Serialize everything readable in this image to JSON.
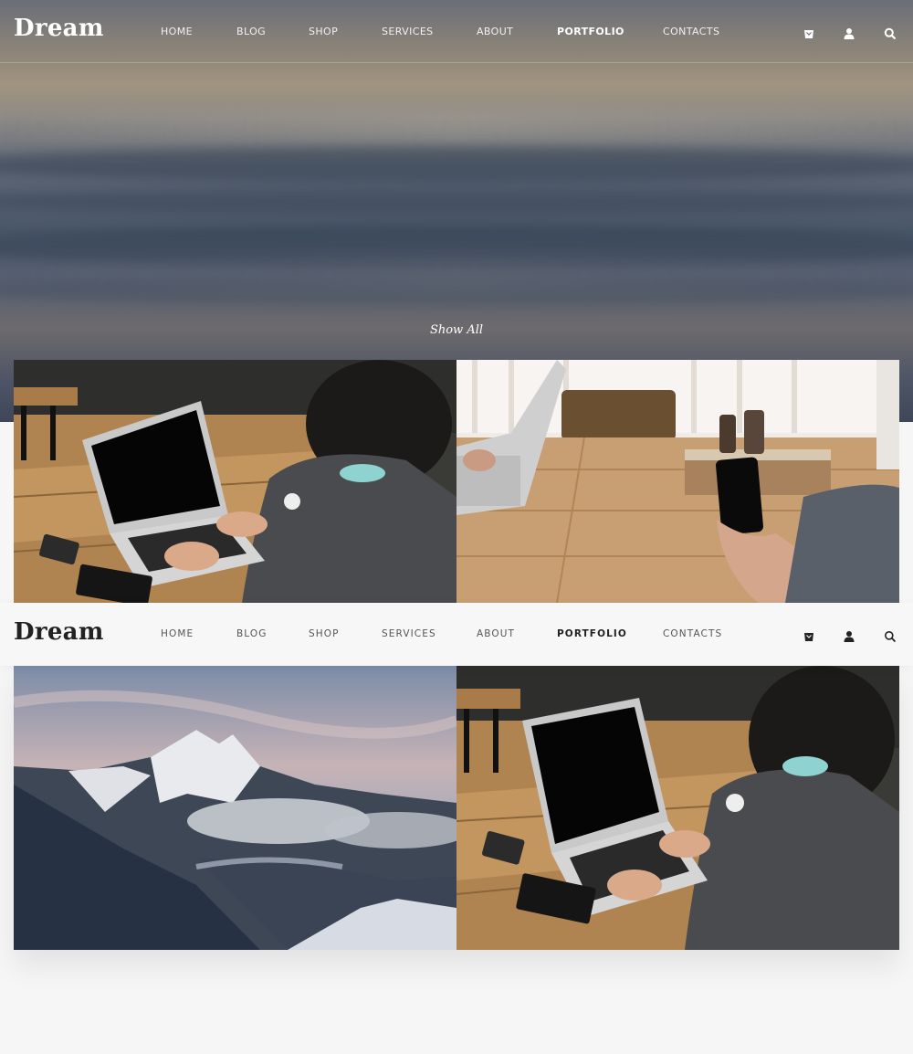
{
  "brand": {
    "logo": "Dream"
  },
  "nav": {
    "items": [
      {
        "label": "HOME"
      },
      {
        "label": "BLOG"
      },
      {
        "label": "SHOP"
      },
      {
        "label": "SERVICES"
      },
      {
        "label": "ABOUT"
      },
      {
        "label": "PORTFOLIO",
        "active": true
      },
      {
        "label": "CONTACTS"
      }
    ]
  },
  "header_icons": [
    "cart-icon",
    "user-icon",
    "search-icon"
  ],
  "filter": {
    "show_all": "Show All"
  },
  "portfolio": {
    "items": [
      {
        "image": "man-with-laptop-on-wooden-table"
      },
      {
        "image": "hand-holding-phone-at-table"
      },
      {
        "image": "snowy-mountain-peak"
      },
      {
        "image": "man-with-laptop-on-wooden-table"
      }
    ]
  },
  "colors": {
    "accent": "#222222",
    "header_light_bg": "#f7f7f7",
    "page_bg": "#f6f6f6"
  }
}
